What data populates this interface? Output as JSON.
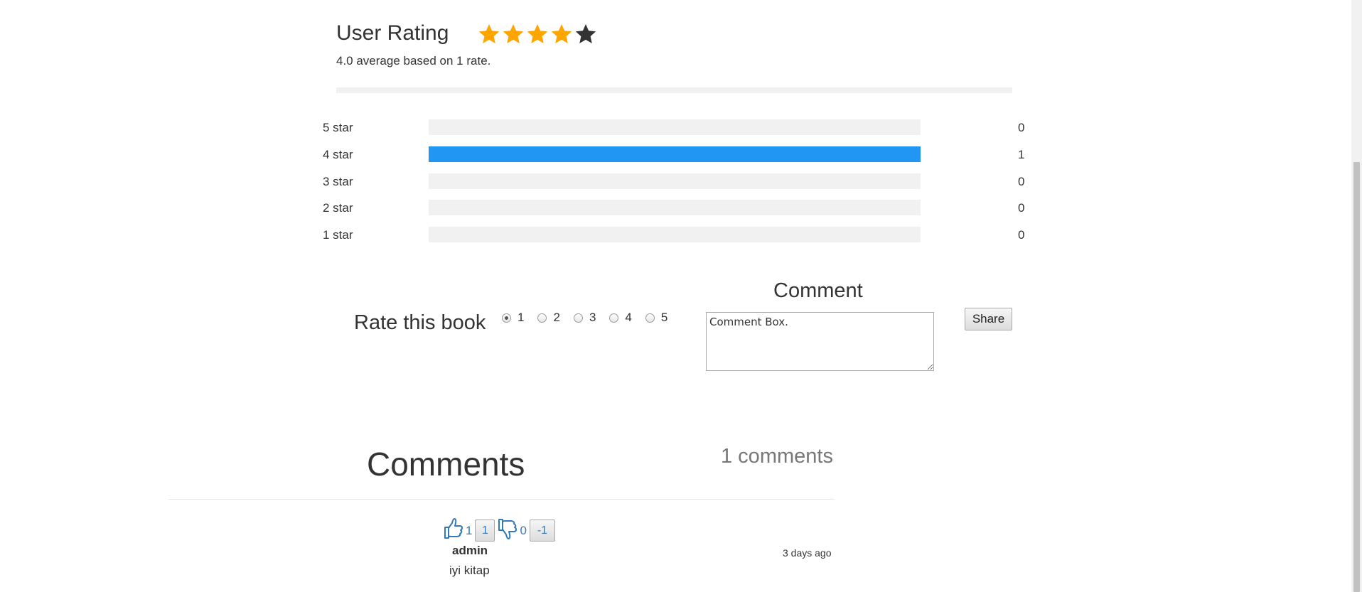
{
  "rating": {
    "heading": "User Rating",
    "stars": [
      {
        "icon": "star-filled-icon",
        "filled": true
      },
      {
        "icon": "star-filled-icon",
        "filled": true
      },
      {
        "icon": "star-filled-icon",
        "filled": true
      },
      {
        "icon": "star-filled-icon",
        "filled": true
      },
      {
        "icon": "star-empty-icon",
        "filled": false
      }
    ],
    "star_color_filled": "#ffa500",
    "star_color_empty": "#333333",
    "average_text": "4.0 average based on 1 rate."
  },
  "distribution": [
    {
      "label": "5 star",
      "count": "0",
      "fraction": 0
    },
    {
      "label": "4 star",
      "count": "1",
      "fraction": 1
    },
    {
      "label": "3 star",
      "count": "0",
      "fraction": 0
    },
    {
      "label": "2 star",
      "count": "0",
      "fraction": 0
    },
    {
      "label": "1 star",
      "count": "0",
      "fraction": 0
    }
  ],
  "bar_color": "#2196F3",
  "rate_form": {
    "label": "Rate this book",
    "options": [
      "1",
      "2",
      "3",
      "4",
      "5"
    ],
    "selected": "1",
    "comment_heading": "Comment",
    "comment_value": "Comment Box.",
    "share_label": "Share"
  },
  "comments": {
    "title": "Comments",
    "count_text": "1 comments",
    "items": [
      {
        "likes": "1",
        "like_button": "1",
        "dislikes": "0",
        "dislike_button": "-1",
        "author": "admin",
        "time": "3 days ago",
        "text": "iyi kitap"
      }
    ]
  }
}
